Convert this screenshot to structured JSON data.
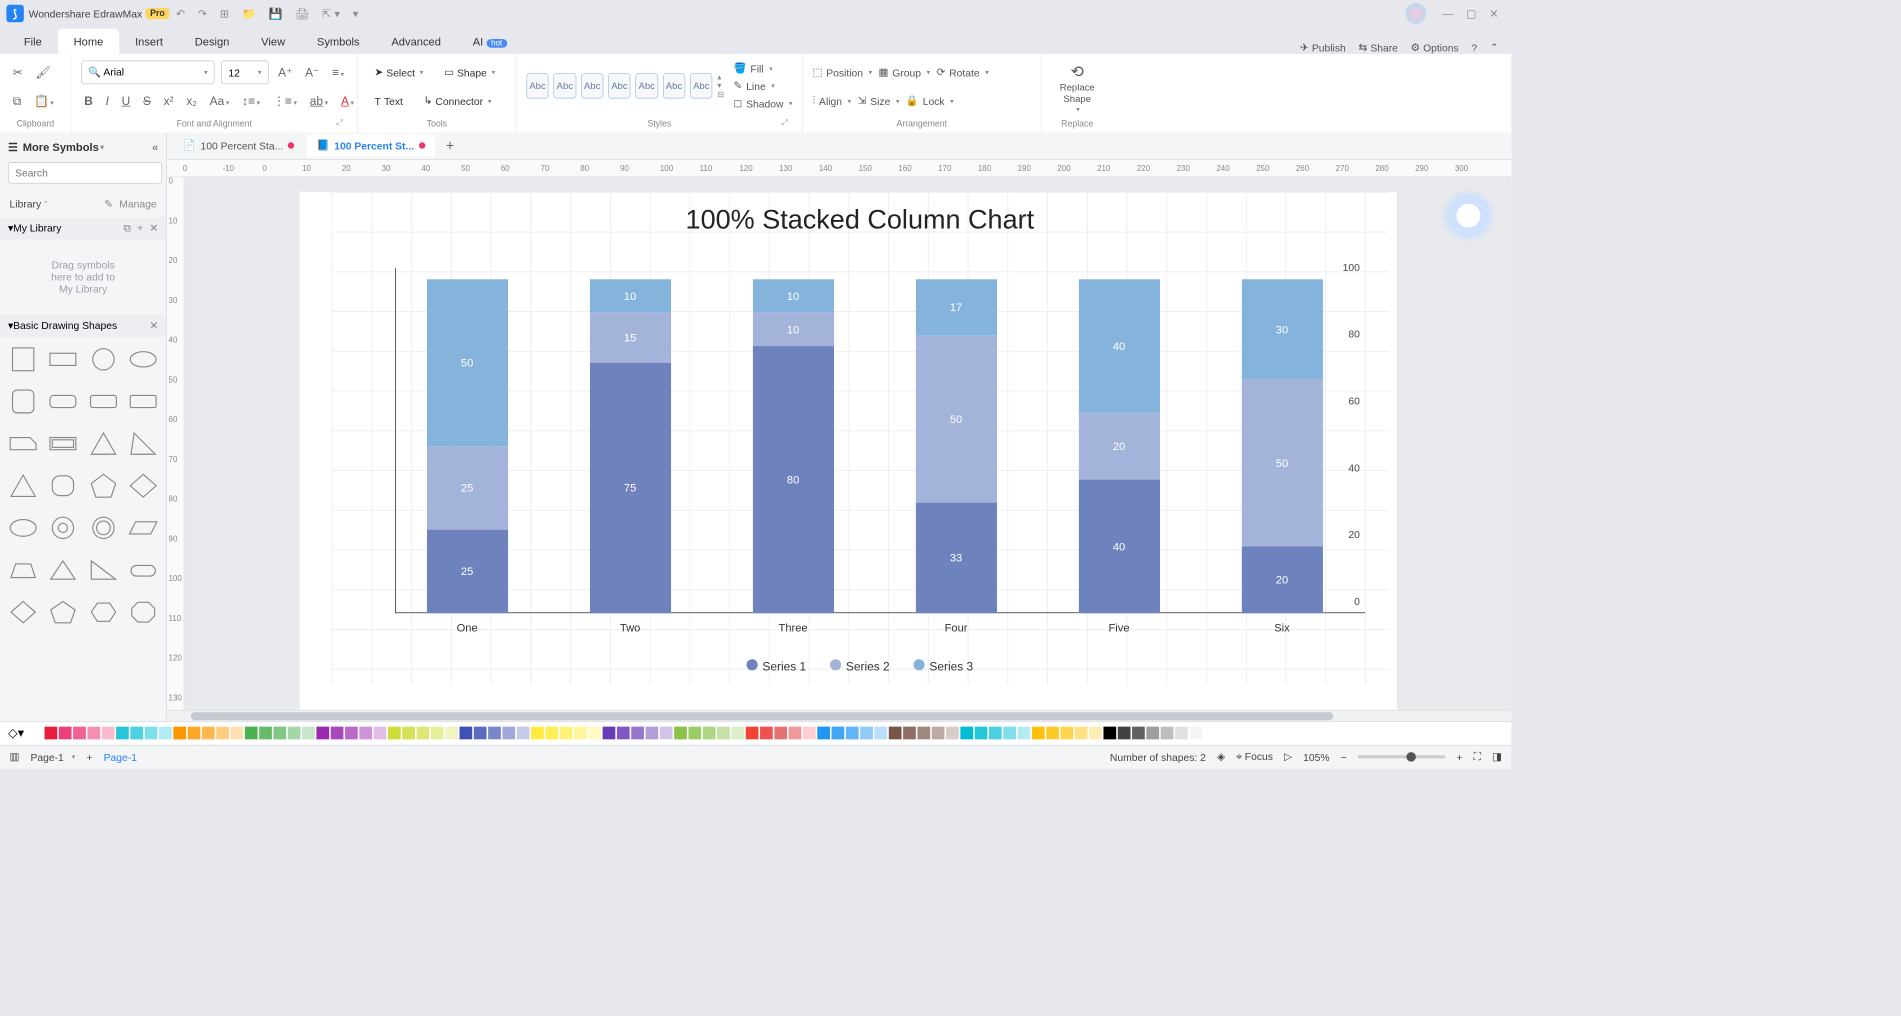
{
  "title_bar": {
    "app_name": "Wondershare EdrawMax",
    "pro_badge": "Pro"
  },
  "menu_tabs": [
    "File",
    "Home",
    "Insert",
    "Design",
    "View",
    "Symbols",
    "Advanced",
    "AI"
  ],
  "menu_active_index": 1,
  "top_right": {
    "publish": "Publish",
    "share": "Share",
    "options": "Options"
  },
  "ribbon": {
    "font_name": "Arial",
    "font_size": "12",
    "select_label": "Select",
    "shape_label": "Shape",
    "text_label": "Text",
    "connector_label": "Connector",
    "style_swatch_text": "Abc",
    "fill": "Fill",
    "line": "Line",
    "shadow": "Shadow",
    "position": "Position",
    "group": "Group",
    "rotate": "Rotate",
    "align": "Align",
    "size": "Size",
    "lock": "Lock",
    "replace_shape": "Replace Shape",
    "sections": {
      "clipboard": "Clipboard",
      "font": "Font and Alignment",
      "tools": "Tools",
      "styles": "Styles",
      "arrangement": "Arrangement",
      "replace": "Replace"
    }
  },
  "left_panel": {
    "more_symbols": "More Symbols",
    "search_placeholder": "Search",
    "search_btn": "Search",
    "library": "Library",
    "manage": "Manage",
    "my_library": "My Library",
    "drop_text1": "Drag symbols",
    "drop_text2": "here to add to",
    "drop_text3": "My Library",
    "shapes_section": "Basic Drawing Shapes"
  },
  "doc_tabs": [
    {
      "label": "100 Percent Sta...",
      "active": false
    },
    {
      "label": "100 Percent St...",
      "active": true
    }
  ],
  "ruler_h_ticks": [
    "0",
    "-10",
    "0",
    "10",
    "20",
    "30",
    "40",
    "50",
    "60",
    "70",
    "80",
    "90",
    "100",
    "110",
    "120",
    "130",
    "140",
    "150",
    "160",
    "170",
    "180",
    "190",
    "200",
    "210",
    "220",
    "230",
    "240",
    "250",
    "260",
    "270",
    "280",
    "290",
    "300"
  ],
  "ruler_v_ticks": [
    "0",
    "10",
    "20",
    "30",
    "40",
    "50",
    "60",
    "70",
    "80",
    "90",
    "100",
    "110",
    "120",
    "130"
  ],
  "chart_data": {
    "type": "stacked_bar_percent",
    "title": "100% Stacked Column Chart",
    "categories": [
      "One",
      "Two",
      "Three",
      "Four",
      "Five",
      "Six"
    ],
    "series": [
      {
        "name": "Series 1",
        "color": "#6e82bd",
        "values": [
          25,
          75,
          80,
          33,
          40,
          20
        ]
      },
      {
        "name": "Series 2",
        "color": "#a4b3da",
        "values": [
          25,
          15,
          10,
          50,
          20,
          50
        ]
      },
      {
        "name": "Series 3",
        "color": "#84b4dc",
        "values": [
          50,
          10,
          10,
          17,
          40,
          30
        ]
      }
    ],
    "ylim": [
      0,
      100
    ],
    "yticks": [
      0,
      20,
      40,
      60,
      80,
      100
    ]
  },
  "color_strip": [
    "#ffffff",
    "#e91e3c",
    "#ec407a",
    "#f06292",
    "#f48fb1",
    "#f8bbd0",
    "#26c6da",
    "#4dd0e1",
    "#80deea",
    "#b2ebf2",
    "#ff9800",
    "#ffa726",
    "#ffb74d",
    "#ffcc80",
    "#ffe0b2",
    "#4caf50",
    "#66bb6a",
    "#81c784",
    "#a5d6a7",
    "#c8e6c9",
    "#9c27b0",
    "#ab47bc",
    "#ba68c8",
    "#ce93d8",
    "#e1bee7",
    "#cddc39",
    "#d4e157",
    "#dce775",
    "#e6ee9c",
    "#f0f4c3",
    "#3f51b5",
    "#5c6bc0",
    "#7986cb",
    "#9fa8da",
    "#c5cae9",
    "#ffeb3b",
    "#ffee58",
    "#fff176",
    "#fff59d",
    "#fff9c4",
    "#673ab7",
    "#7e57c2",
    "#9575cd",
    "#b39ddb",
    "#d1c4e9",
    "#8bc34a",
    "#9ccc65",
    "#aed581",
    "#c5e1a5",
    "#dcedc8",
    "#f44336",
    "#ef5350",
    "#e57373",
    "#ef9a9a",
    "#ffcdd2",
    "#2196f3",
    "#42a5f5",
    "#64b5f6",
    "#90caf9",
    "#bbdefb",
    "#795548",
    "#8d6e63",
    "#a1887f",
    "#bcaaa4",
    "#d7ccc8",
    "#00bcd4",
    "#26c6da",
    "#4dd0e1",
    "#80deea",
    "#b2ebf2",
    "#ffc107",
    "#ffca28",
    "#ffd54f",
    "#ffe082",
    "#ffecb3",
    "#000000",
    "#424242",
    "#616161",
    "#9e9e9e",
    "#bdbdbd",
    "#e0e0e0",
    "#f5f5f5"
  ],
  "status_bar": {
    "page_select": "Page-1",
    "page_active": "Page-1",
    "shapes_count": "Number of shapes: 2",
    "focus": "Focus",
    "zoom": "105%"
  }
}
